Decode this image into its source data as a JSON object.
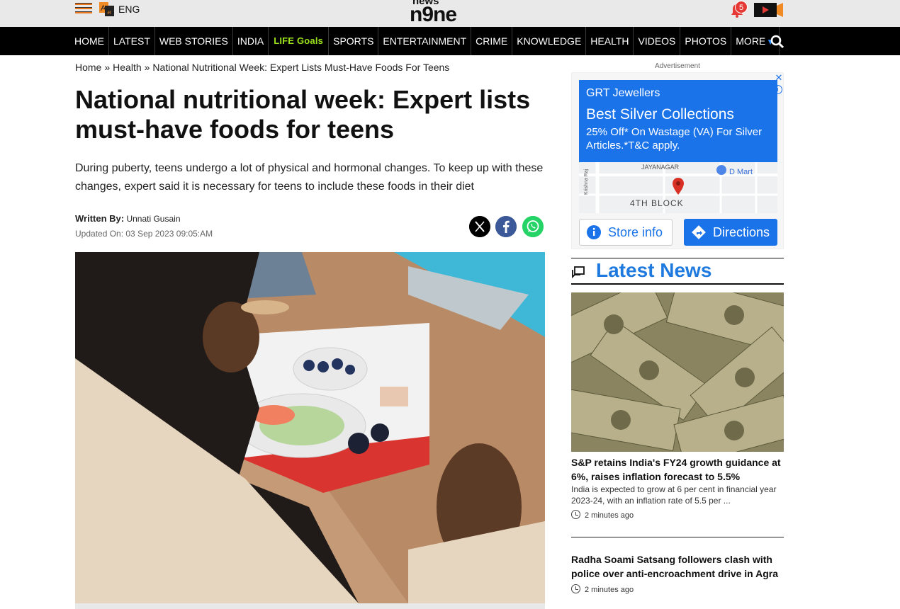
{
  "header": {
    "lang_icon_text": "A",
    "language": "ENG",
    "logo_top": "news",
    "logo_main": "n9ne",
    "notification_count": "5"
  },
  "nav": {
    "items": [
      "HOME",
      "LATEST",
      "WEB STORIES",
      "INDIA",
      "LIFE Goals",
      "SPORTS",
      "ENTERTAINMENT",
      "CRIME",
      "KNOWLEDGE",
      "HEALTH",
      "VIDEOS",
      "PHOTOS",
      "MORE"
    ]
  },
  "breadcrumb": {
    "home": "Home",
    "section": "Health",
    "current": "National Nutritional Week: Expert Lists Must-Have Foods For Teens",
    "separator": "»"
  },
  "article": {
    "headline": "National nutritional week: Expert lists must-have foods for teens",
    "summary": "During puberty, teens undergo a lot of physical and hormonal changes. To keep up with these changes, expert said it is necessary for teens to include these foods in their diet",
    "author_label": "Written By:",
    "author": "Unnati Gusain",
    "updated": "Updated On: 03 Sep 2023 09:05:AM"
  },
  "ad": {
    "label": "Advertisement",
    "brand": "GRT Jewellers",
    "title": "Best Silver Collections",
    "subtitle": "25% Off* On Wastage (VA) For Silver Articles.*T&C apply.",
    "map_label_area": "JAYANAGAR",
    "map_label_block": "4TH BLOCK",
    "map_label_store": "D Mart",
    "map_label_road": "Krishna Raj",
    "store_button": "Store info",
    "directions_button": "Directions"
  },
  "latest_news": {
    "title": "Latest News",
    "items": [
      {
        "headline": "S&P retains India's FY24 growth guidance at 6%, raises inflation forecast to 5.5%",
        "description": "India is expected to grow at 6 per cent in financial year 2023-24, with an inflation rate of 5.5 per ...",
        "time": "2 minutes ago"
      },
      {
        "headline": "Radha Soami Satsang followers clash with police over anti-encroachment drive in Agra",
        "time": "2 minutes ago"
      }
    ]
  },
  "colors": {
    "accent_blue": "#1f7ae0",
    "life_goals_green": "#9be31a",
    "ad_blue": "#1a73e8",
    "navbar_bg": "#000000",
    "topbar_bg": "#e9e9e9"
  }
}
